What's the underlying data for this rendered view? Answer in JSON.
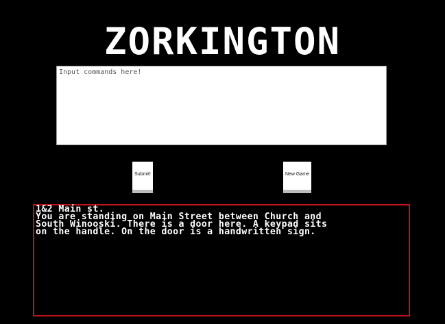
{
  "game": {
    "title": "ZORKINGTON",
    "command_placeholder": "Input commands here!",
    "submit_label": "Submit!",
    "new_game_label": "New Game",
    "output": {
      "location": "1&2 Main st.",
      "lines": [
        "You are standing on Main Street between Church and",
        "South Winooski. There is a door here. A keypad sits",
        "on the handle. On the door is a handwritten sign."
      ]
    }
  }
}
